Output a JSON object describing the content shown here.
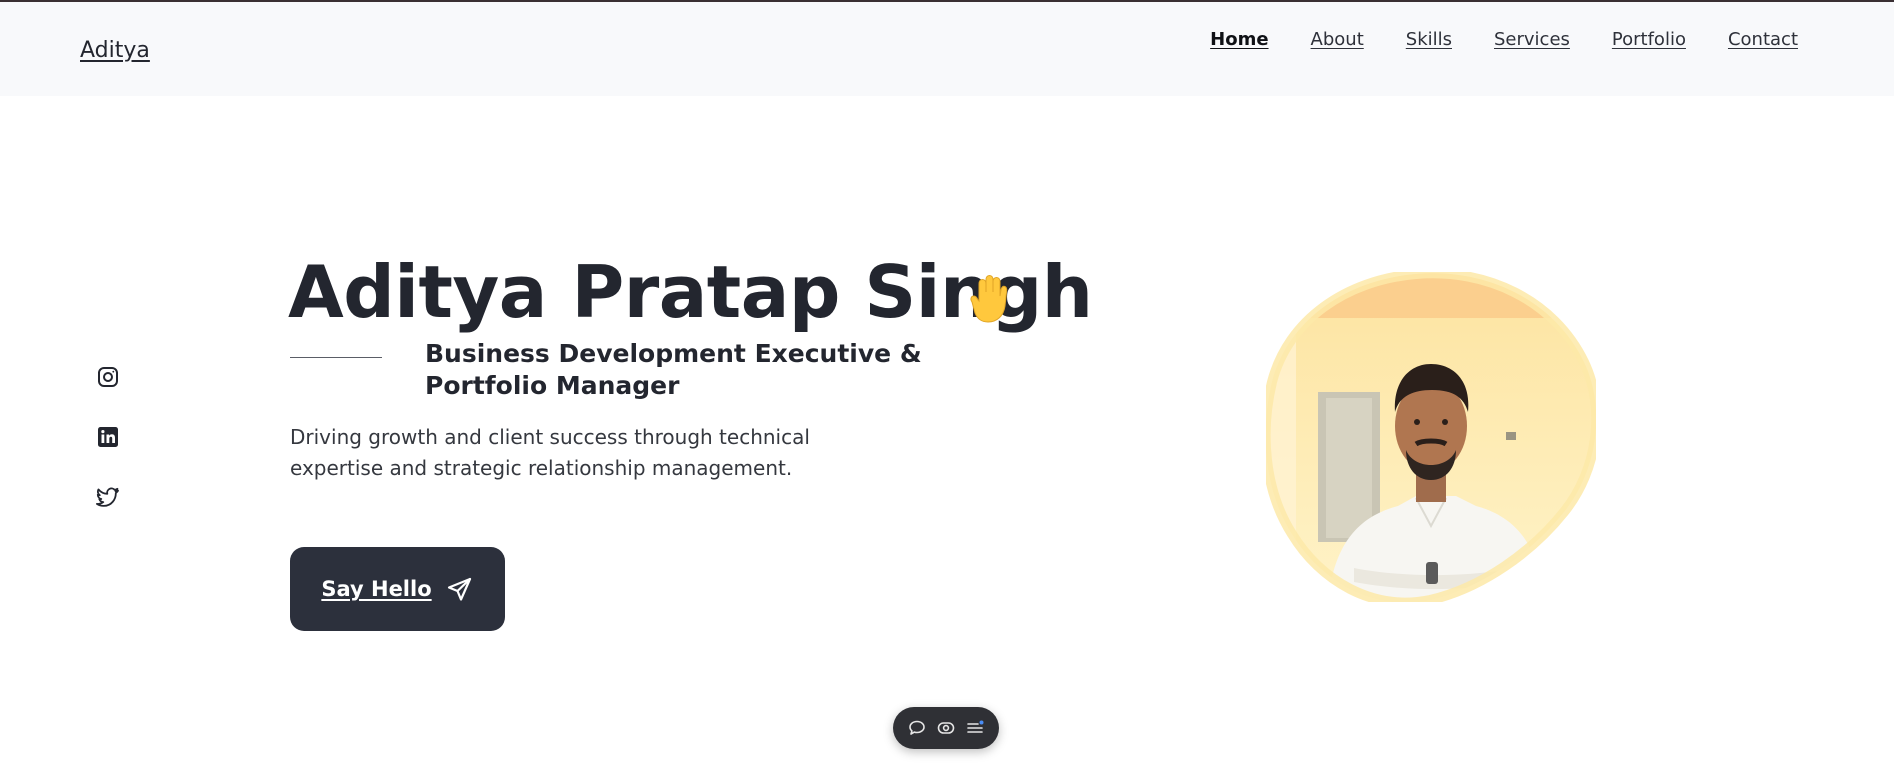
{
  "header": {
    "logo": "Aditya",
    "nav": [
      "Home",
      "About",
      "Skills",
      "Services",
      "Portfolio",
      "Contact"
    ],
    "active": "Home"
  },
  "social": [
    "instagram-icon",
    "linkedin-icon",
    "twitter-icon"
  ],
  "hero": {
    "name": "Aditya Pratap Singh",
    "wave": "waving-hand-icon",
    "subtitle": "Business Development Executive & Portfolio Manager",
    "description": "Driving growth and client success through technical expertise and strategic relationship management.",
    "cta_label": "Say Hello",
    "cta_icon": "send-icon"
  },
  "floating_toolbar": [
    "comment-icon",
    "eye-icon",
    "menu-icon"
  ],
  "colors": {
    "header_bg": "#f8f9fb",
    "text": "#23262f",
    "button_bg": "#2c303c",
    "portrait_blob": "#fde9a8"
  }
}
